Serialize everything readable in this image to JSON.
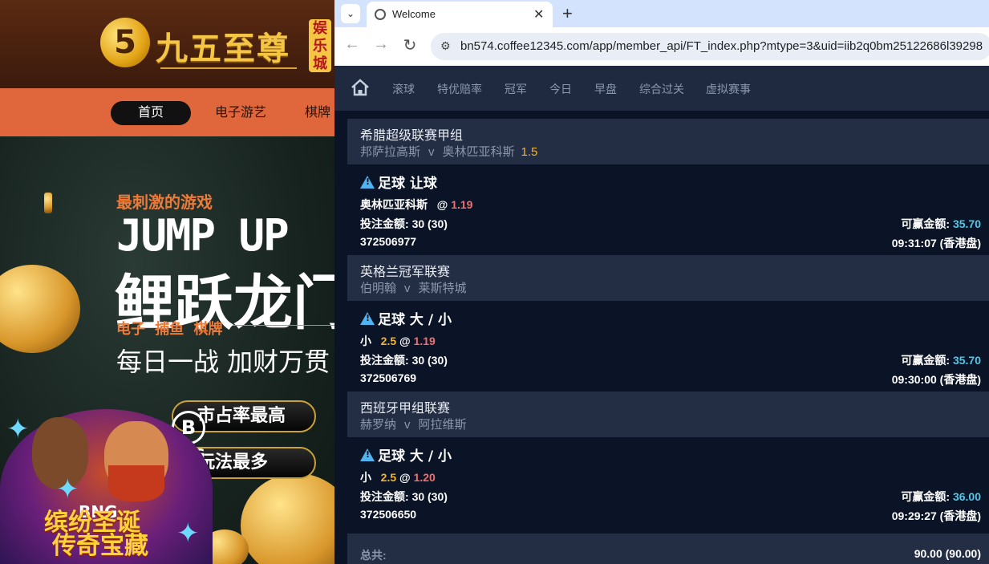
{
  "left_site": {
    "logo_mark": "5",
    "logo_text": "九五至尊",
    "logo_badge": "娱乐城",
    "nav": [
      "首页",
      "电子游艺",
      "棋牌"
    ],
    "promo": {
      "subtitle": "最刺激的游戏",
      "title": "JUMP UP",
      "headline": "鲤跃龙门",
      "categories": "电子 捕鱼 棋牌",
      "slogan": "每日一战 加财万贯",
      "pill1": "市占率最高",
      "pill2": "玩法最多",
      "provider_logo": "B",
      "provider": "BNG",
      "game_title_1": "缤纷圣诞",
      "game_title_2": "传奇宝藏"
    }
  },
  "browser": {
    "tab_title": "Welcome",
    "url": "bn574.coffee12345.com/app/member_api/FT_index.php?mtype=3&uid=iib2q0bm25122686l39298"
  },
  "app": {
    "nav": [
      "滚球",
      "特优赔率",
      "冠军",
      "今日",
      "早盘",
      "综合过关",
      "虚拟赛事"
    ],
    "bets": [
      {
        "league": "希腊超级联赛甲组",
        "home": "邦萨拉高斯",
        "vs": "v",
        "away": "奥林匹亚科斯",
        "handicap": "1.5",
        "type": "足球 让球",
        "selection": "奥林匹亚科斯",
        "at": "@",
        "odds": "1.19",
        "stake_label": "投注金额:",
        "stake": "30 (30)",
        "win_label": "可赢金额:",
        "win": "35.70",
        "id": "372506977",
        "time": "09:31:07 (香港盘)"
      },
      {
        "league": "英格兰冠军联赛",
        "home": "伯明翰",
        "vs": "v",
        "away": "莱斯特城",
        "handicap": "",
        "type": "足球 大 / 小",
        "selection": "小",
        "line": "2.5",
        "at": "@",
        "odds": "1.19",
        "stake_label": "投注金额:",
        "stake": "30 (30)",
        "win_label": "可赢金额:",
        "win": "35.70",
        "id": "372506769",
        "time": "09:30:00 (香港盘)"
      },
      {
        "league": "西班牙甲组联赛",
        "home": "赫罗纳",
        "vs": "v",
        "away": "阿拉维斯",
        "handicap": "",
        "type": "足球 大 / 小",
        "selection": "小",
        "line": "2.5",
        "at": "@",
        "odds": "1.20",
        "stake_label": "投注金额:",
        "stake": "30 (30)",
        "win_label": "可赢金额:",
        "win": "36.00",
        "id": "372506650",
        "time": "09:29:27 (香港盘)"
      }
    ],
    "total_label": "总共:",
    "total_value": "90.00 (90.00)"
  }
}
